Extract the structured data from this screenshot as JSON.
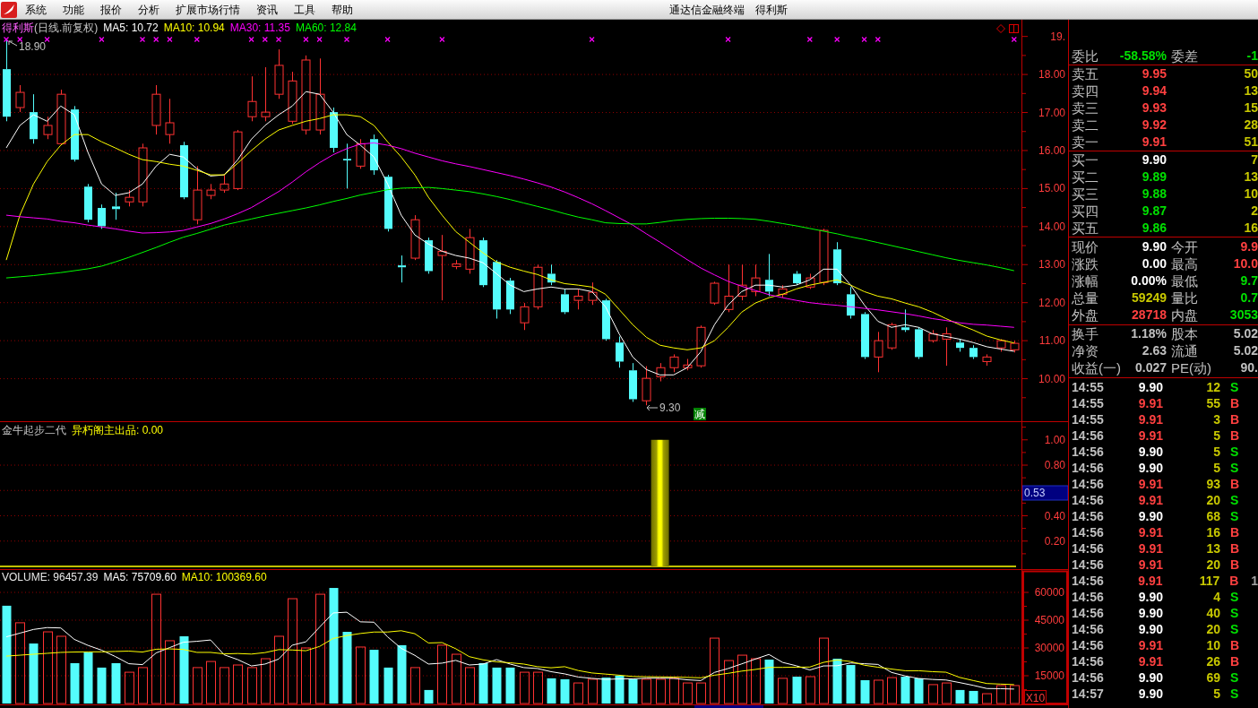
{
  "menu_bar": {
    "items": [
      "系统",
      "功能",
      "报价",
      "分析",
      "扩展市场行情",
      "资讯",
      "工具",
      "帮助"
    ],
    "title": "通达信金融终端",
    "stock": "得利斯"
  },
  "price_chart": {
    "stock": "得利斯",
    "period": "(日线.前复权)",
    "ma_legend": [
      "MA5: 10.72",
      "MA10: 10.94",
      "MA30: 11.35",
      "MA60: 12.84"
    ],
    "high_label": "18.90",
    "low_label": "9.30",
    "signal_badge": "减",
    "chart_data": {
      "type": "candlestick",
      "ylim": [
        8.87,
        19.44
      ],
      "grid": true,
      "yticks": [
        {
          "value": 19,
          "label": "19."
        },
        {
          "value": 18,
          "label": "18.00"
        },
        {
          "value": 17,
          "label": "17.00"
        },
        {
          "value": 16,
          "label": "16.00"
        },
        {
          "value": 15,
          "label": "15.00"
        },
        {
          "value": 14,
          "label": "14.00"
        },
        {
          "value": 13,
          "label": "13.00"
        },
        {
          "value": 12,
          "label": "12.00"
        },
        {
          "value": 11,
          "label": "11.00"
        },
        {
          "value": 10,
          "label": "10.00"
        }
      ],
      "ohlc": [
        [
          18.14,
          18.9,
          16.77,
          16.89
        ],
        [
          17.13,
          17.72,
          17.01,
          17.53
        ],
        [
          17.01,
          17.48,
          16.18,
          16.3
        ],
        [
          16.42,
          16.89,
          16.3,
          16.66
        ],
        [
          16.18,
          17.6,
          16.14,
          17.48
        ],
        [
          17.08,
          17.17,
          15.71,
          15.76
        ],
        [
          15.05,
          15.12,
          14.11,
          14.18
        ],
        [
          14.49,
          14.58,
          13.94,
          14.01
        ],
        [
          14.53,
          14.89,
          14.18,
          14.46
        ],
        [
          14.65,
          14.96,
          14.53,
          14.77
        ],
        [
          14.65,
          16.18,
          14.53,
          16.07
        ],
        [
          16.66,
          17.72,
          16.42,
          17.48
        ],
        [
          16.42,
          17.36,
          16.18,
          16.73
        ],
        [
          16.14,
          16.23,
          14.72,
          14.77
        ],
        [
          14.18,
          15.59,
          14.06,
          14.96
        ],
        [
          14.82,
          15.12,
          14.72,
          14.96
        ],
        [
          14.96,
          15.36,
          14.89,
          15.12
        ],
        [
          15.0,
          16.54,
          14.96,
          16.49
        ],
        [
          16.89,
          17.95,
          16.77,
          17.29
        ],
        [
          16.89,
          18.19,
          16.77,
          17.01
        ],
        [
          17.48,
          18.66,
          17.36,
          18.24
        ],
        [
          16.77,
          18.07,
          16.7,
          17.83
        ],
        [
          16.54,
          18.5,
          16.42,
          18.38
        ],
        [
          16.54,
          18.42,
          16.42,
          17.48
        ],
        [
          17.01,
          17.13,
          15.95,
          16.07
        ],
        [
          15.78,
          16.18,
          15.0,
          15.74
        ],
        [
          15.59,
          16.3,
          15.52,
          16.18
        ],
        [
          16.3,
          16.42,
          15.36,
          15.48
        ],
        [
          15.31,
          15.36,
          13.87,
          13.94
        ],
        [
          12.98,
          13.24,
          12.53,
          12.93
        ],
        [
          13.17,
          14.3,
          13.12,
          14.18
        ],
        [
          13.64,
          13.71,
          12.76,
          12.83
        ],
        [
          13.24,
          13.78,
          12.06,
          13.35
        ],
        [
          12.95,
          13.12,
          12.88,
          13.02
        ],
        [
          12.88,
          13.94,
          12.76,
          13.71
        ],
        [
          13.64,
          13.71,
          12.41,
          12.46
        ],
        [
          13.07,
          13.12,
          11.58,
          11.82
        ],
        [
          12.58,
          12.65,
          11.7,
          11.82
        ],
        [
          11.47,
          11.99,
          11.28,
          11.89
        ],
        [
          11.89,
          13.0,
          11.82,
          12.93
        ],
        [
          12.76,
          13.0,
          12.46,
          12.53
        ],
        [
          12.22,
          12.36,
          11.7,
          11.75
        ],
        [
          12.06,
          12.36,
          11.82,
          12.17
        ],
        [
          12.06,
          12.53,
          11.94,
          12.27
        ],
        [
          12.06,
          12.1,
          11.0,
          11.04
        ],
        [
          10.95,
          11.11,
          10.29,
          10.45
        ],
        [
          10.22,
          10.41,
          9.39,
          9.46
        ],
        [
          9.42,
          10.33,
          9.3,
          10.01
        ],
        [
          10.05,
          10.41,
          9.93,
          10.29
        ],
        [
          10.29,
          10.64,
          10.17,
          10.57
        ],
        [
          10.29,
          10.52,
          10.22,
          10.36
        ],
        [
          10.34,
          11.4,
          10.29,
          11.35
        ],
        [
          11.99,
          12.55,
          11.94,
          12.51
        ],
        [
          11.82,
          13.0,
          11.75,
          12.17
        ],
        [
          12.17,
          13.0,
          12.06,
          12.46
        ],
        [
          12.29,
          13.0,
          12.17,
          12.65
        ],
        [
          12.6,
          13.28,
          12.17,
          12.29
        ],
        [
          12.22,
          12.46,
          12.13,
          12.36
        ],
        [
          12.76,
          12.83,
          12.46,
          12.51
        ],
        [
          12.41,
          12.76,
          12.36,
          12.65
        ],
        [
          12.53,
          13.94,
          12.46,
          13.9
        ],
        [
          13.4,
          13.59,
          12.46,
          12.51
        ],
        [
          12.22,
          12.41,
          11.58,
          11.66
        ],
        [
          11.7,
          11.75,
          10.52,
          10.57
        ],
        [
          10.57,
          11.23,
          10.17,
          11.0
        ],
        [
          10.81,
          11.47,
          10.76,
          11.42
        ],
        [
          11.35,
          11.82,
          11.23,
          11.28
        ],
        [
          11.3,
          11.35,
          10.52,
          10.57
        ],
        [
          11.0,
          11.28,
          10.95,
          11.18
        ],
        [
          11.04,
          11.35,
          10.34,
          11.18
        ],
        [
          10.95,
          11.04,
          10.71,
          10.81
        ],
        [
          10.81,
          10.88,
          10.52,
          10.57
        ],
        [
          10.45,
          10.64,
          10.34,
          10.57
        ],
        [
          10.81,
          11.04,
          10.71,
          11.0
        ],
        [
          10.76,
          11.0,
          10.69,
          10.93
        ]
      ],
      "series": [
        {
          "type": "line",
          "color": "#ffffff",
          "values": [
            16.07,
            16.66,
            16.94,
            16.77,
            17.17,
            16.94,
            15.95,
            15.12,
            14.82,
            14.89,
            15.12,
            15.59,
            15.9,
            15.83,
            15.52,
            15.33,
            15.36,
            15.76,
            16.3,
            16.66,
            16.94,
            17.17,
            17.55,
            17.48,
            17.01,
            16.42,
            16.14,
            15.83,
            15.12,
            14.3,
            13.78,
            13.54,
            13.35,
            13.24,
            13.17,
            13.05,
            12.76,
            12.46,
            12.29,
            12.36,
            12.41,
            12.36,
            12.36,
            12.29,
            11.89,
            11.18,
            10.57,
            10.24,
            10.1,
            10.1,
            10.29,
            10.71,
            11.42,
            11.94,
            12.29,
            12.46,
            12.46,
            12.41,
            12.46,
            12.6,
            12.88,
            12.88,
            12.46,
            11.94,
            11.51,
            11.35,
            11.42,
            11.35,
            11.18,
            11.11,
            11.04,
            10.95,
            10.84,
            10.78,
            10.72
          ]
        },
        {
          "type": "line",
          "color": "#ffff00",
          "values": [
            13.12,
            14.3,
            15.12,
            15.71,
            16.14,
            16.42,
            16.42,
            16.23,
            16.07,
            15.9,
            15.76,
            15.71,
            15.64,
            15.59,
            15.48,
            15.36,
            15.36,
            15.67,
            16.0,
            16.3,
            16.54,
            16.66,
            16.77,
            16.84,
            16.94,
            16.94,
            16.89,
            16.66,
            16.23,
            15.83,
            15.36,
            14.77,
            14.3,
            13.87,
            13.59,
            13.31,
            13.07,
            12.93,
            12.83,
            12.74,
            12.6,
            12.5,
            12.46,
            12.41,
            12.22,
            11.82,
            11.42,
            11.09,
            10.88,
            10.81,
            10.76,
            10.81,
            11.0,
            11.35,
            11.75,
            11.99,
            12.13,
            12.22,
            12.36,
            12.46,
            12.53,
            12.6,
            12.46,
            12.29,
            12.17,
            12.1,
            11.99,
            11.89,
            11.75,
            11.58,
            11.42,
            11.28,
            11.12,
            11.02,
            10.94
          ]
        },
        {
          "type": "line",
          "color": "#ff00ff",
          "values": [
            14.3,
            14.26,
            14.23,
            14.2,
            14.14,
            14.1,
            14.04,
            13.99,
            13.94,
            13.88,
            13.83,
            13.84,
            13.86,
            13.9,
            13.99,
            14.08,
            14.2,
            14.34,
            14.5,
            14.71,
            14.92,
            15.17,
            15.44,
            15.68,
            15.89,
            16.05,
            16.17,
            16.2,
            16.14,
            16.05,
            15.93,
            15.83,
            15.73,
            15.65,
            15.58,
            15.5,
            15.42,
            15.34,
            15.25,
            15.15,
            15.04,
            14.91,
            14.76,
            14.6,
            14.42,
            14.23,
            14.04,
            13.81,
            13.59,
            13.36,
            13.13,
            12.91,
            12.73,
            12.56,
            12.43,
            12.32,
            12.21,
            12.13,
            12.06,
            12.0,
            11.96,
            11.93,
            11.89,
            11.85,
            11.81,
            11.76,
            11.71,
            11.65,
            11.58,
            11.53,
            11.47,
            11.43,
            11.41,
            11.38,
            11.35
          ]
        },
        {
          "type": "line",
          "color": "#00ff00",
          "values": [
            12.65,
            12.68,
            12.71,
            12.75,
            12.79,
            12.84,
            12.89,
            12.96,
            13.07,
            13.19,
            13.32,
            13.45,
            13.59,
            13.72,
            13.82,
            13.93,
            14.04,
            14.12,
            14.2,
            14.28,
            14.35,
            14.42,
            14.49,
            14.57,
            14.66,
            14.74,
            14.83,
            14.9,
            14.97,
            15.01,
            15.02,
            15.03,
            15.0,
            14.96,
            14.92,
            14.86,
            14.79,
            14.71,
            14.62,
            14.53,
            14.44,
            14.34,
            14.25,
            14.18,
            14.1,
            14.08,
            14.07,
            14.07,
            14.11,
            14.16,
            14.19,
            14.21,
            14.22,
            14.22,
            14.21,
            14.19,
            14.14,
            14.08,
            14.02,
            13.95,
            13.88,
            13.81,
            13.73,
            13.66,
            13.58,
            13.5,
            13.42,
            13.34,
            13.26,
            13.18,
            13.11,
            13.05,
            12.99,
            12.92,
            12.84
          ]
        }
      ]
    }
  },
  "indicator": {
    "name": "金牛起步二代",
    "value_label": "异朽阁主出品: 0.00",
    "cursor_label": "0.53",
    "chart_data": {
      "type": "bar",
      "ylim": [
        0,
        1.14
      ],
      "grid": true,
      "yticks": [
        {
          "value": 0.2,
          "label": "0.20"
        },
        {
          "value": 0.4,
          "label": "0.40"
        },
        {
          "value": 0.8,
          "label": "0.80"
        },
        {
          "value": 1,
          "label": "1.00"
        }
      ],
      "values": [
        0,
        0,
        0,
        0,
        0,
        0,
        0,
        0,
        0,
        0,
        0,
        0,
        0,
        0,
        0,
        0,
        0,
        0,
        0,
        0,
        0,
        0,
        0,
        0,
        0,
        0,
        0,
        0,
        0,
        0,
        0,
        0,
        0,
        0,
        0,
        0,
        0,
        0,
        0,
        0,
        0,
        0,
        0,
        0,
        0,
        0,
        0,
        0,
        1,
        0,
        0,
        0,
        0,
        0,
        0,
        0,
        0,
        0,
        0,
        0,
        0,
        0,
        0,
        0,
        0,
        0,
        0,
        0,
        0,
        0,
        0,
        0,
        0,
        0,
        0
      ]
    }
  },
  "volume_chart": {
    "legend": [
      {
        "label": "VOLUME: 96457.39",
        "color": "#e8e8e8"
      },
      {
        "label": "MA5: 75709.60",
        "color": "#ffffff"
      },
      {
        "label": "MA10: 100369.60",
        "color": "#ffff00"
      }
    ],
    "scale_button": "X10",
    "chart_data": {
      "type": "bar",
      "ylim": [
        0,
        72100
      ],
      "grid": true,
      "yticks": [
        {
          "value": 15000,
          "label": "15000"
        },
        {
          "value": 30000,
          "label": "30000"
        },
        {
          "value": 45000,
          "label": "45000"
        },
        {
          "value": 60000,
          "label": "60000"
        }
      ],
      "values": [
        52800,
        43600,
        32400,
        38700,
        36300,
        21800,
        27600,
        19400,
        21800,
        16900,
        19400,
        59000,
        33900,
        36300,
        19400,
        22700,
        19400,
        20800,
        19400,
        24200,
        36300,
        56600,
        30000,
        59000,
        62400,
        38700,
        30500,
        29000,
        19400,
        31500,
        19400,
        7300,
        31500,
        26600,
        19400,
        21800,
        19400,
        19400,
        16900,
        16900,
        13600,
        13100,
        11100,
        13100,
        14000,
        15000,
        13100,
        13100,
        13100,
        13600,
        11100,
        11100,
        35300,
        23200,
        26100,
        24200,
        23700,
        13600,
        14500,
        14500,
        35300,
        24200,
        20800,
        12600,
        12600,
        14000,
        14500,
        13600,
        10200,
        11100,
        7300,
        6800,
        5300,
        9700,
        9700
      ],
      "colors": [
        "#54fcfc",
        "#ff3232",
        "#54fcfc",
        "#ff3232",
        "#ff3232",
        "#54fcfc",
        "#54fcfc",
        "#54fcfc",
        "#54fcfc",
        "#ff3232",
        "#ff3232",
        "#ff3232",
        "#ff3232",
        "#54fcfc",
        "#ff3232",
        "#ff3232",
        "#ff3232",
        "#ff3232",
        "#ff3232",
        "#ff3232",
        "#ff3232",
        "#ff3232",
        "#ff3232",
        "#ff3232",
        "#54fcfc",
        "#54fcfc",
        "#ff3232",
        "#54fcfc",
        "#54fcfc",
        "#54fcfc",
        "#ff3232",
        "#54fcfc",
        "#ff3232",
        "#ff3232",
        "#ff3232",
        "#54fcfc",
        "#54fcfc",
        "#54fcfc",
        "#ff3232",
        "#ff3232",
        "#54fcfc",
        "#54fcfc",
        "#ff3232",
        "#ff3232",
        "#54fcfc",
        "#54fcfc",
        "#54fcfc",
        "#ff3232",
        "#ff3232",
        "#ff3232",
        "#ff3232",
        "#ff3232",
        "#ff3232",
        "#ff3232",
        "#ff3232",
        "#ff3232",
        "#54fcfc",
        "#ff3232",
        "#54fcfc",
        "#ff3232",
        "#ff3232",
        "#54fcfc",
        "#54fcfc",
        "#54fcfc",
        "#ff3232",
        "#ff3232",
        "#54fcfc",
        "#54fcfc",
        "#ff3232",
        "#ff3232",
        "#54fcfc",
        "#54fcfc",
        "#ff3232",
        "#ff3232",
        "#ff3232"
      ],
      "series": [
        {
          "type": "line",
          "color": "#ffffff",
          "values": [
            36000,
            38000,
            40000,
            41000,
            40800,
            34600,
            31400,
            28800,
            25400,
            21500,
            21000,
            27300,
            30200,
            33100,
            33600,
            34300,
            26300,
            23700,
            20300,
            21300,
            24000,
            31500,
            33300,
            41200,
            48900,
            49300,
            44100,
            43900,
            36000,
            29800,
            26000,
            21300,
            21800,
            23300,
            20800,
            21300,
            23700,
            21300,
            19400,
            18900,
            17200,
            16000,
            14300,
            13600,
            13000,
            13300,
            13300,
            13700,
            13700,
            13600,
            12800,
            12400,
            16800,
            18900,
            21400,
            24000,
            26500,
            22200,
            20400,
            18100,
            20300,
            20400,
            21900,
            21500,
            21100,
            16800,
            14900,
            13500,
            13000,
            12700,
            11300,
            9800,
            8100,
            8000,
            7800
          ]
        },
        {
          "type": "line",
          "color": "#ffff00",
          "values": [
            25600,
            26100,
            26600,
            27100,
            27600,
            27800,
            27900,
            27900,
            28100,
            28300,
            27800,
            29300,
            29500,
            29200,
            27600,
            27600,
            26800,
            27000,
            26700,
            27500,
            29100,
            28900,
            28500,
            30800,
            35100,
            36700,
            37800,
            38600,
            38600,
            39300,
            37700,
            32700,
            32900,
            29600,
            25300,
            23600,
            22500,
            22000,
            21300,
            19900,
            19300,
            19900,
            17800,
            16500,
            15900,
            15300,
            14600,
            14500,
            14400,
            14300,
            14100,
            13900,
            15300,
            16300,
            17500,
            18400,
            19500,
            19500,
            19600,
            19700,
            22200,
            23500,
            22700,
            20700,
            19600,
            18600,
            17700,
            17700,
            17200,
            16900,
            14100,
            12400,
            10800,
            10500,
            10200
          ]
        }
      ]
    }
  },
  "quote_panel": {
    "order_ratio": [
      {
        "label": "委比",
        "value": "-58.58%",
        "color": "#00e000"
      },
      {
        "label": "委差",
        "value": "-1",
        "color": "#00e000"
      }
    ],
    "sell_orders": [
      {
        "label": "卖五",
        "price": "9.95",
        "color": "#ff4040",
        "volume": "50"
      },
      {
        "label": "卖四",
        "price": "9.94",
        "color": "#ff4040",
        "volume": "13"
      },
      {
        "label": "卖三",
        "price": "9.93",
        "color": "#ff4040",
        "volume": "15"
      },
      {
        "label": "卖二",
        "price": "9.92",
        "color": "#ff4040",
        "volume": "28"
      },
      {
        "label": "卖一",
        "price": "9.91",
        "color": "#ff4040",
        "volume": "51"
      }
    ],
    "buy_orders": [
      {
        "label": "买一",
        "price": "9.90",
        "color": "#ffffff",
        "volume": "7"
      },
      {
        "label": "买二",
        "price": "9.89",
        "color": "#00e000",
        "volume": "13"
      },
      {
        "label": "买三",
        "price": "9.88",
        "color": "#00e000",
        "volume": "10"
      },
      {
        "label": "买四",
        "price": "9.87",
        "color": "#00e000",
        "volume": "2"
      },
      {
        "label": "买五",
        "price": "9.86",
        "color": "#00e000",
        "volume": "16"
      }
    ],
    "stats": [
      {
        "label": "现价",
        "value": "9.90",
        "color": "#ffffff"
      },
      {
        "label": "今开",
        "value": "9.9",
        "color": "#ff4040"
      },
      {
        "label": "涨跌",
        "value": "0.00",
        "color": "#ffffff"
      },
      {
        "label": "最高",
        "value": "10.0",
        "color": "#ff4040"
      },
      {
        "label": "涨幅",
        "value": "0.00%",
        "color": "#ffffff"
      },
      {
        "label": "最低",
        "value": "9.7",
        "color": "#00e000"
      },
      {
        "label": "总量",
        "value": "59249",
        "color": "#c8c800"
      },
      {
        "label": "量比",
        "value": "0.7",
        "color": "#00e000"
      },
      {
        "label": "外盘",
        "value": "28718",
        "color": "#ff4040"
      },
      {
        "label": "内盘",
        "value": "3053",
        "color": "#00e000"
      }
    ],
    "fundamentals": [
      {
        "label": "换手",
        "value": "1.18%"
      },
      {
        "label": "股本",
        "value": "5.02"
      },
      {
        "label": "净资",
        "value": "2.63"
      },
      {
        "label": "流通",
        "value": "5.02"
      },
      {
        "label": "收益(一)",
        "value": "0.027"
      },
      {
        "label": "PE(动)",
        "value": "90."
      }
    ],
    "trades": [
      {
        "time": "14:55",
        "price": "9.90",
        "color": "#ffffff",
        "volume": "12",
        "side": "S",
        "kind": "sell"
      },
      {
        "time": "14:55",
        "price": "9.91",
        "color": "#ff4040",
        "volume": "55",
        "side": "B",
        "kind": "buy"
      },
      {
        "time": "14:55",
        "price": "9.91",
        "color": "#ff4040",
        "volume": "3",
        "side": "B",
        "kind": "buy"
      },
      {
        "time": "14:56",
        "price": "9.91",
        "color": "#ff4040",
        "volume": "5",
        "side": "B",
        "kind": "buy"
      },
      {
        "time": "14:56",
        "price": "9.90",
        "color": "#ffffff",
        "volume": "5",
        "side": "S",
        "kind": "sell"
      },
      {
        "time": "14:56",
        "price": "9.90",
        "color": "#ffffff",
        "volume": "5",
        "side": "S",
        "kind": "sell"
      },
      {
        "time": "14:56",
        "price": "9.91",
        "color": "#ff4040",
        "volume": "93",
        "side": "B",
        "kind": "buy"
      },
      {
        "time": "14:56",
        "price": "9.91",
        "color": "#ff4040",
        "volume": "20",
        "side": "S",
        "kind": "sell"
      },
      {
        "time": "14:56",
        "price": "9.90",
        "color": "#ffffff",
        "volume": "68",
        "side": "S",
        "kind": "sell"
      },
      {
        "time": "14:56",
        "price": "9.91",
        "color": "#ff4040",
        "volume": "16",
        "side": "B",
        "kind": "buy"
      },
      {
        "time": "14:56",
        "price": "9.91",
        "color": "#ff4040",
        "volume": "13",
        "side": "B",
        "kind": "buy"
      },
      {
        "time": "14:56",
        "price": "9.91",
        "color": "#ff4040",
        "volume": "20",
        "side": "B",
        "kind": "buy"
      },
      {
        "time": "14:56",
        "price": "9.91",
        "color": "#ff4040",
        "volume": "117",
        "side": "B",
        "kind": "buy",
        "column_5": "1"
      },
      {
        "time": "14:56",
        "price": "9.90",
        "color": "#ffffff",
        "volume": "4",
        "side": "S",
        "kind": "sell"
      },
      {
        "time": "14:56",
        "price": "9.90",
        "color": "#ffffff",
        "volume": "40",
        "side": "S",
        "kind": "sell"
      },
      {
        "time": "14:56",
        "price": "9.90",
        "color": "#ffffff",
        "volume": "20",
        "side": "S",
        "kind": "sell"
      },
      {
        "time": "14:56",
        "price": "9.91",
        "color": "#ff4040",
        "volume": "10",
        "side": "B",
        "kind": "buy"
      },
      {
        "time": "14:56",
        "price": "9.91",
        "color": "#ff4040",
        "volume": "26",
        "side": "B",
        "kind": "buy"
      },
      {
        "time": "14:56",
        "price": "9.90",
        "color": "#ffffff",
        "volume": "69",
        "side": "S",
        "kind": "sell"
      },
      {
        "time": "14:57",
        "price": "9.90",
        "color": "#ffffff",
        "volume": "5",
        "side": "S",
        "kind": "sell"
      }
    ]
  }
}
